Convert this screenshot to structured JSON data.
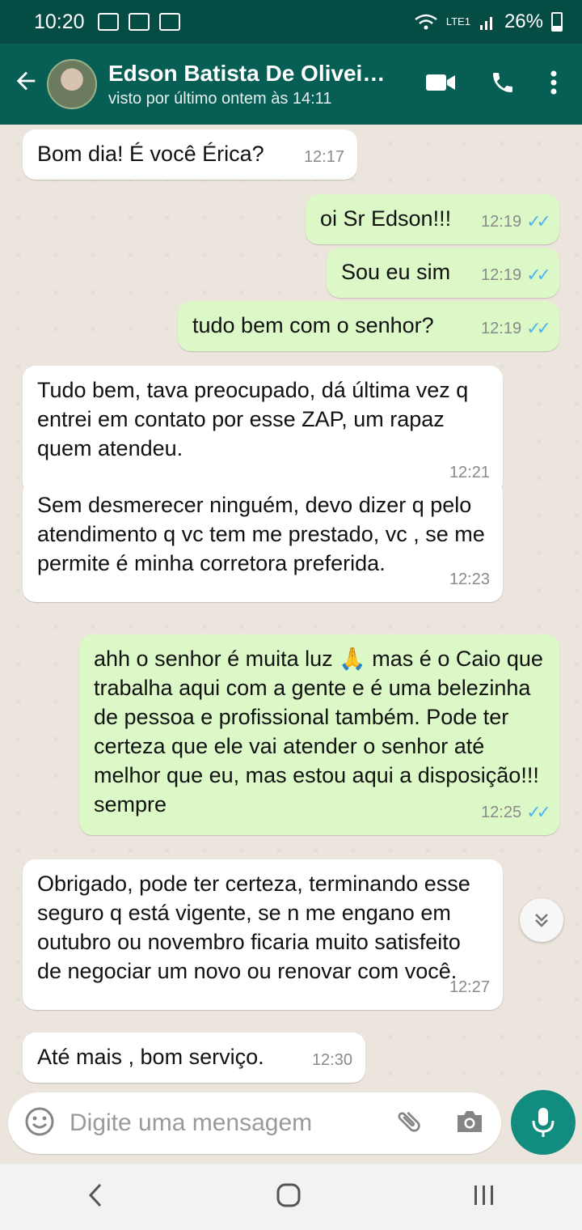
{
  "statusbar": {
    "time": "10:20",
    "network": "LTE1",
    "battery": "26%"
  },
  "header": {
    "back_icon": "arrow-back-icon",
    "contact_name": "Edson Batista De Olivei…",
    "contact_status": "visto por último ontem às 14:11",
    "action_icons": [
      "video-call-icon",
      "phone-icon",
      "more-vert-icon"
    ]
  },
  "messages": [
    {
      "dir": "in",
      "text": "Bom dia! É você Érica?",
      "time": "12:17"
    },
    {
      "dir": "out",
      "text": "oi Sr Edson!!!",
      "time": "12:19"
    },
    {
      "dir": "out",
      "text": "Sou eu sim",
      "time": "12:19"
    },
    {
      "dir": "out",
      "text": "tudo bem com o senhor?",
      "time": "12:19"
    },
    {
      "dir": "in",
      "text": "Tudo bem, tava preocupado, dá última vez q entrei em contato por esse ZAP, um rapaz quem atendeu.",
      "time": "12:21"
    },
    {
      "dir": "in",
      "text": "Sem desmerecer ninguém, devo dizer q pelo atendimento q vc tem me prestado, vc , se me permite é minha  corretora preferida.",
      "time": "12:23"
    },
    {
      "dir": "out",
      "text": "ahh o senhor é muita luz 🙏 mas é o Caio que trabalha aqui com a gente e é uma belezinha de pessoa e profissional também. Pode ter certeza que ele vai atender o senhor até melhor que eu, mas estou aqui a disposição!!! sempre",
      "time": "12:25"
    },
    {
      "dir": "in",
      "text": "Obrigado, pode ter certeza, terminando esse seguro q está vigente, se n me engano em outubro ou novembro ficaria muito satisfeito de negociar um novo ou renovar com você.",
      "time": "12:27"
    },
    {
      "dir": "in",
      "text": "Até mais , bom serviço.",
      "time": "12:30"
    }
  ],
  "composer": {
    "placeholder": "Digite uma mensagem"
  },
  "colors": {
    "header": "#075e54",
    "statusbar": "#054d44",
    "outgoing": "#dcf8c6",
    "incoming": "#ffffff",
    "read_ticks": "#4fb6ec",
    "mic": "#128c7e"
  }
}
